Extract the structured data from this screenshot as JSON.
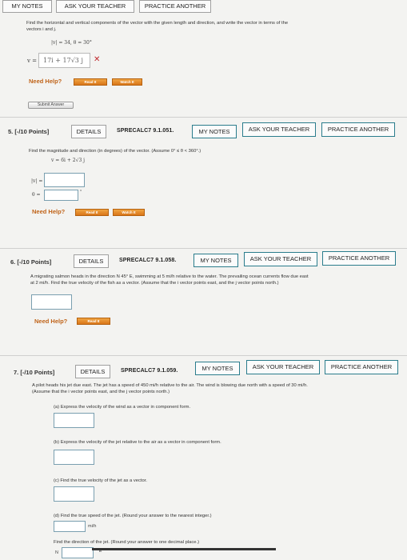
{
  "prev": {
    "tabs": [
      "MY NOTES",
      "ASK YOUR TEACHER",
      "PRACTICE ANOTHER"
    ],
    "prompt_line1": "Find the horizontal and vertical components of the vector with the given length and direction, and write the vector in terms of the",
    "prompt_line2": "vectors i and j.",
    "given": "|v| = 34,   θ = 30°",
    "v_label": "v =",
    "answer": "17i + 17√3 j",
    "wrong_mark": "✕",
    "need_help": "Need Help?",
    "read_it": "Read It",
    "watch_it": "Watch It",
    "submit": "Submit Answer"
  },
  "q5": {
    "number": "5.  [-/10 Points]",
    "details": "DETAILS",
    "code": "SPRECALC7 9.1.051.",
    "my_notes": "MY NOTES",
    "ask": "ASK YOUR TEACHER",
    "practice": "PRACTICE ANOTHER",
    "prompt": "Find the magnitude and direction (in degrees) of the vector. (Assume 0° ≤ θ < 360°.)",
    "vector": "v = 6i + 2√3 j",
    "mag_label": "|v| =",
    "dir_label": "θ =",
    "deg": "°",
    "need_help": "Need Help?",
    "read_it": "Read It",
    "watch_it": "Watch It"
  },
  "q6": {
    "number": "6.  [-/10 Points]",
    "details": "DETAILS",
    "code": "SPRECALC7 9.1.058.",
    "my_notes": "MY NOTES",
    "ask": "ASK YOUR TEACHER",
    "practice": "PRACTICE ANOTHER",
    "prompt_line1": "A migrating salmon heads in the direction N 45° E, swimming at 5 mi/h relative to the water. The prevailing ocean currents flow due east",
    "prompt_line2": "at 2 mi/h. Find the true velocity of the fish as a vector. (Assume that the i vector points east, and the j vector points north.)",
    "need_help": "Need Help?",
    "read_it": "Read It"
  },
  "q7": {
    "number": "7.  [-/10 Points]",
    "details": "DETAILS",
    "code": "SPRECALC7 9.1.059.",
    "my_notes": "MY NOTES",
    "ask": "ASK YOUR TEACHER",
    "practice": "PRACTICE ANOTHER",
    "prompt_line1": "A pilot heads his jet due east. The jet has a speed of 450 mi/h relative to the air. The wind is blowing due north with a speed of 30 mi/h.",
    "prompt_line2": "(Assume that the i vector points east, and the j vector points north.)",
    "part_a": "(a) Express the velocity of the wind as a vector in component form.",
    "part_b": "(b) Express the velocity of the jet relative to the air as a vector in component form.",
    "part_c": "(c) Find the true velocity of the jet as a vector.",
    "part_d": "(d) Find the true speed of the jet. (Round your answer to the nearest integer.)",
    "speed_unit": "mi/h",
    "direction_prompt": "Find the direction of the jet. (Round your answer to one decimal place.)",
    "dir_prefix": "N",
    "dir_suffix": "° E"
  }
}
